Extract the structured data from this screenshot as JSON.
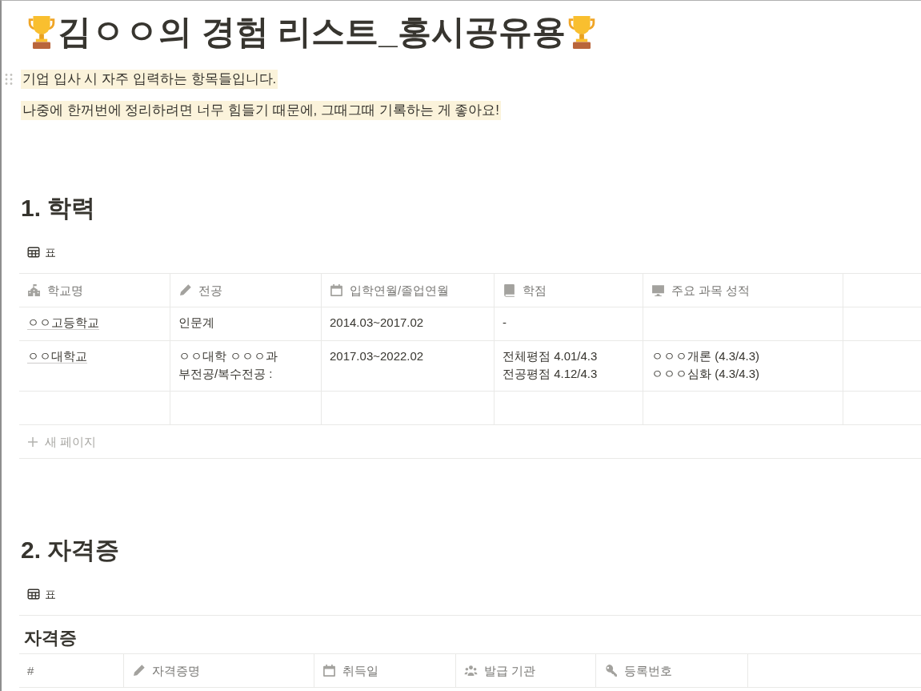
{
  "page": {
    "title": "김ㅇㅇ의 경험 리스트_홍시공유용"
  },
  "notes": [
    {
      "text": "기업 입사 시 자주 입력하는 항목들입니다.",
      "highlighted": true,
      "hovered": true
    },
    {
      "text": "나중에 한꺼번에 정리하려면 너무 힘들기 때문에, 그때그때 기록하는 게 좋아요!",
      "highlighted": true,
      "hovered": false
    }
  ],
  "sections": [
    {
      "heading": "1. 학력",
      "view_tab": "표",
      "table": {
        "columns": [
          "학교명",
          "전공",
          "입학연월/졸업연월",
          "학점",
          "주요 과목 성적"
        ],
        "rows": [
          [
            "ㅇㅇ고등학교",
            "인문계",
            "2014.03~2017.02",
            "-"
          ],
          [
            "ㅇㅇ대학교",
            "ㅇㅇ대학 ㅇㅇㅇ과\n부전공/복수전공 :",
            "2017.03~2022.02",
            "전체평점 4.01/4.3\n전공평점 4.12/4.3",
            "ㅇㅇㅇ개론 (4.3/4.3)\nㅇㅇㅇ심화 (4.3/4.3)"
          ]
        ],
        "add_row": "새 페이지"
      }
    },
    {
      "heading": "2. 자격증",
      "view_tab": "표",
      "table": {
        "title": "자격증",
        "columns": [
          "#",
          "자격증명",
          "취득일",
          "발급 기관",
          "등록번호"
        ]
      }
    }
  ]
}
